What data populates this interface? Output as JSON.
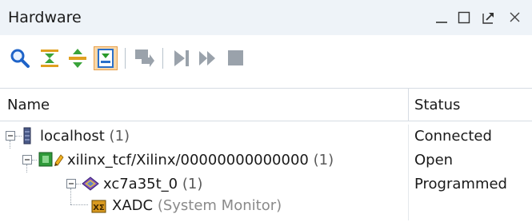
{
  "window": {
    "title": "Hardware"
  },
  "titlebar_buttons": [
    {
      "name": "minimize-icon"
    },
    {
      "name": "maximize-icon"
    },
    {
      "name": "float-icon"
    },
    {
      "name": "close-icon"
    }
  ],
  "toolbar": {
    "buttons": [
      {
        "name": "search-icon"
      },
      {
        "name": "collapse-all-icon"
      },
      {
        "name": "expand-all-icon"
      },
      {
        "name": "auto-connect-icon",
        "active": true
      },
      {
        "name": "program-device-icon"
      },
      {
        "name": "run-trigger-icon"
      },
      {
        "name": "run-trigger-immediate-icon"
      },
      {
        "name": "stop-trigger-icon"
      }
    ]
  },
  "columns": {
    "name": "Name",
    "status": "Status"
  },
  "tree": {
    "rows": [
      {
        "label": "localhost",
        "count": "(1)",
        "status": "Connected",
        "icon": "server-icon"
      },
      {
        "label": "xilinx_tcf/Xilinx/00000000000000",
        "count": "(1)",
        "status": "Open",
        "icon": "jtag-target-icon"
      },
      {
        "label": "xc7a35t_0",
        "count": "(1)",
        "status": "Programmed",
        "icon": "fpga-device-icon"
      },
      {
        "label": "XADC",
        "suffix": "(System Monitor)",
        "status": "",
        "icon": "xadc-icon"
      }
    ]
  },
  "colors": {
    "titlebar_bg": "#eef3f8",
    "active_button_bg": "#f9d7a8",
    "active_button_border": "#e8a04a",
    "grid_line": "#d6dce3"
  }
}
